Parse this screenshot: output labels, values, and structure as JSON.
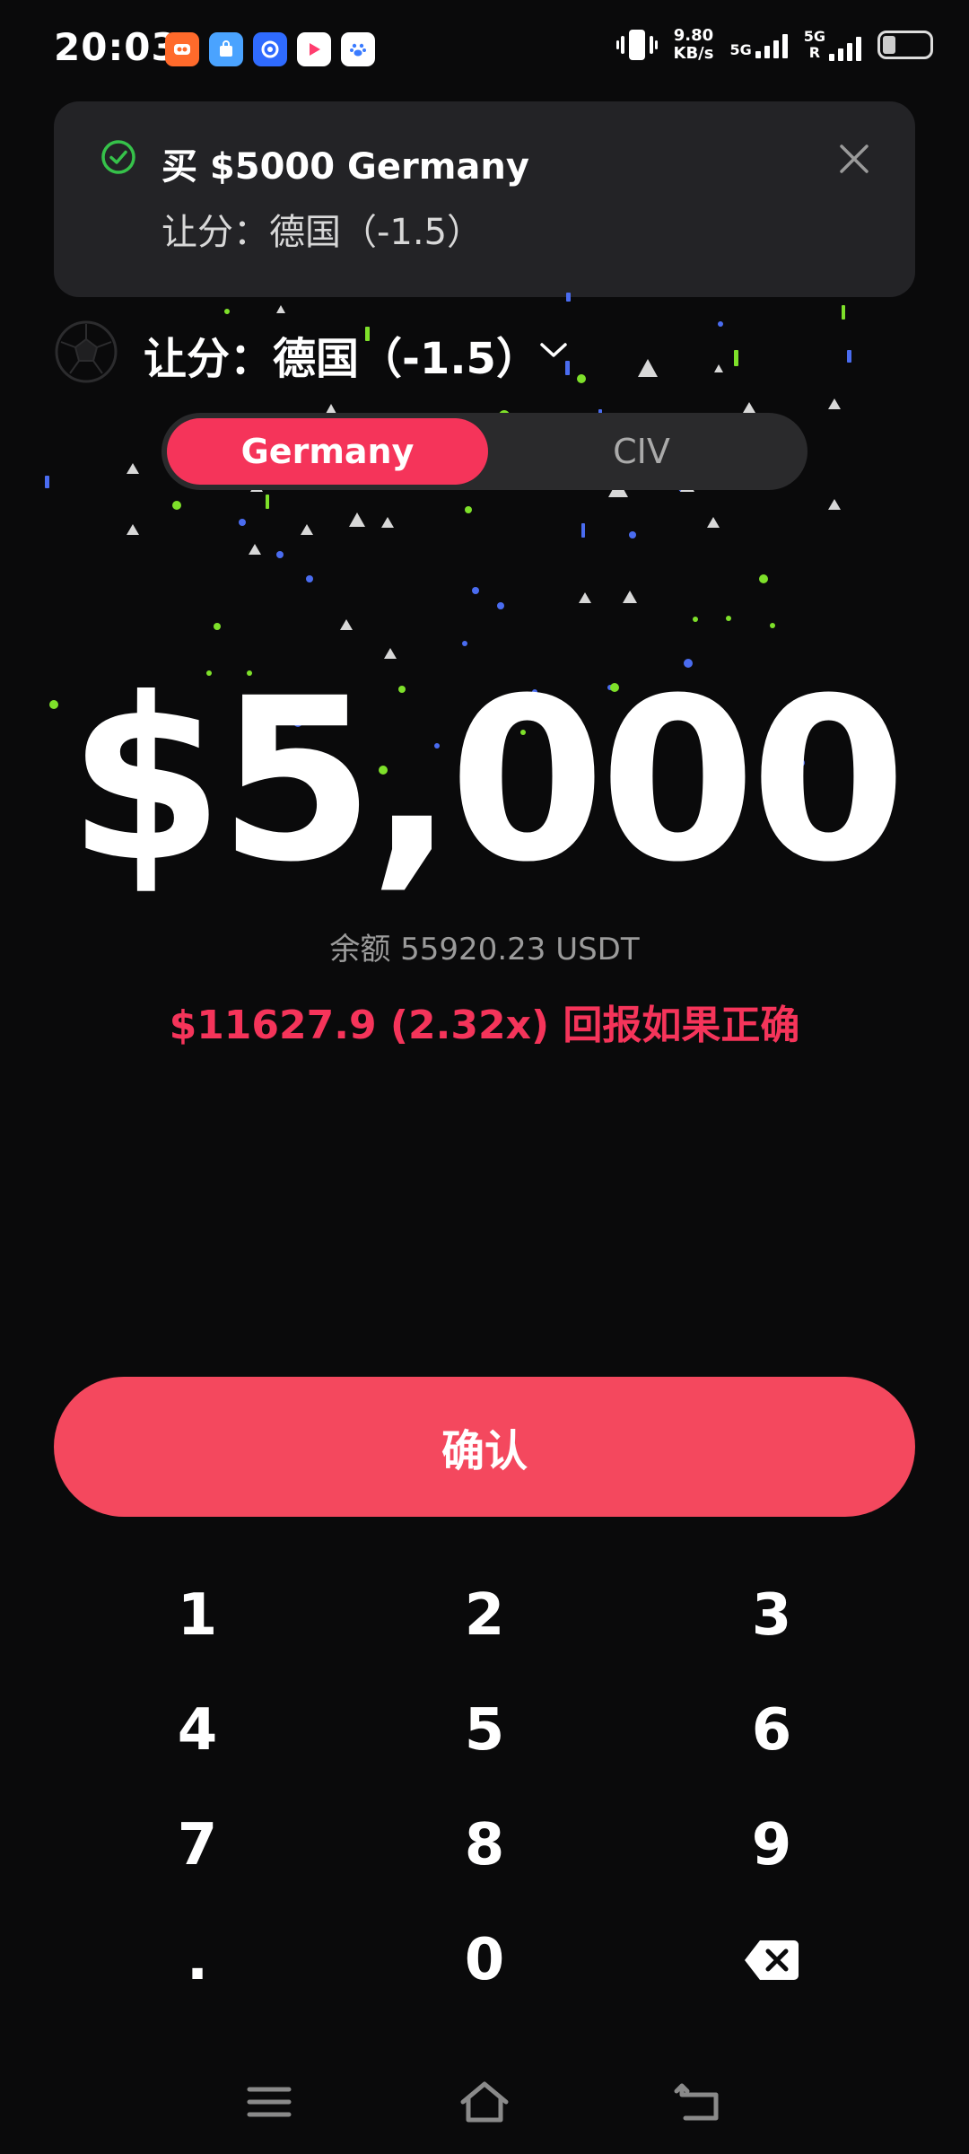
{
  "status": {
    "time": "20:03",
    "speed_value": "9.80",
    "speed_unit": "KB/s",
    "net1": "5G",
    "net2": "5G",
    "net2_sub": "R",
    "apps": [
      {
        "icon": "kuaishou-app-icon",
        "color": "#ff6a2b"
      },
      {
        "icon": "shopping-app-icon",
        "color": "#4aa3ff"
      },
      {
        "icon": "browser-app-icon",
        "color": "#2f6bff"
      },
      {
        "icon": "video-app-icon",
        "color": "#ff3d6e"
      },
      {
        "icon": "baidu-app-icon",
        "color": "#3a7bff"
      }
    ]
  },
  "toast": {
    "title": "买 $5000 Germany",
    "subtitle": "让分：德国（-1.5）"
  },
  "market": {
    "title": "让分：德国（-1.5）"
  },
  "toggle": {
    "option_a": "Germany",
    "option_b": "CIV",
    "selected": "Germany"
  },
  "bet": {
    "amount": "$5,000",
    "balance": "余额 55920.23 USDT",
    "payout": "$11627.9 (2.32x) 回报如果正确"
  },
  "confirm_label": "确认",
  "keypad": {
    "keys": [
      "1",
      "2",
      "3",
      "4",
      "5",
      "6",
      "7",
      "8",
      "9",
      ".",
      "0"
    ]
  },
  "colors": {
    "accent": "#f5345a",
    "confirm": "#f4485e",
    "success": "#36c24a",
    "background": "#0a0a0b",
    "card": "#232326"
  }
}
